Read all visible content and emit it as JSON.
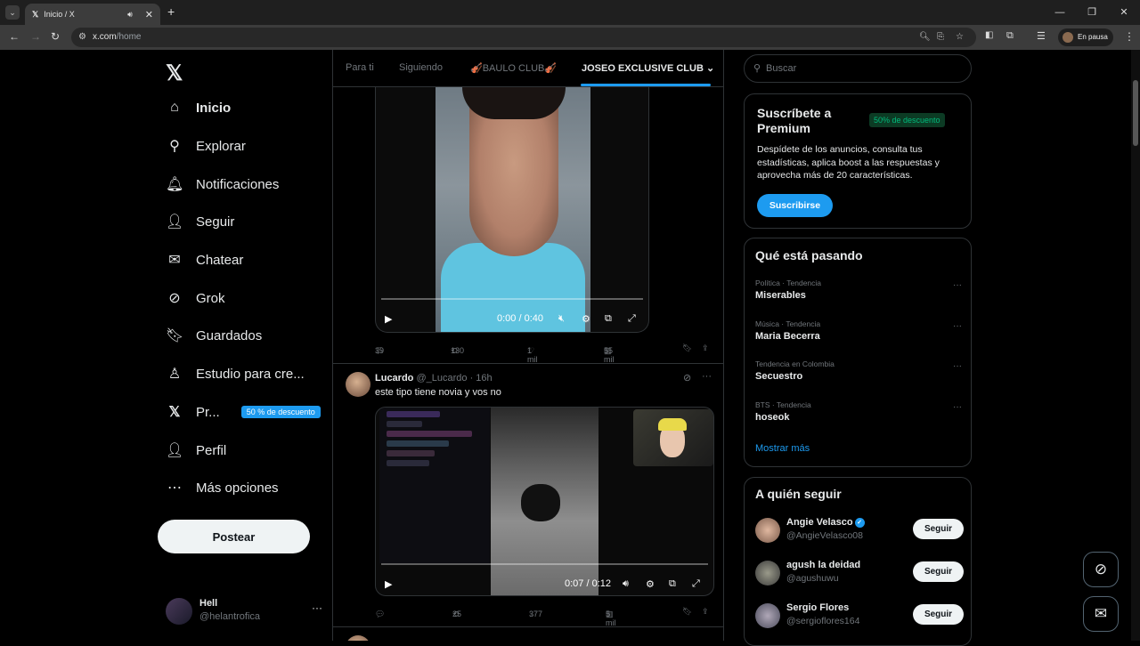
{
  "browser": {
    "tab_title": "Inicio / X",
    "tab_icon": "x-logo-icon",
    "url_domain": "x.com",
    "url_path": "/home",
    "profile_status": "En pausa"
  },
  "sidebar": {
    "logo": "𝕏",
    "items": [
      {
        "label": "Inicio",
        "icon": "home-icon"
      },
      {
        "label": "Explorar",
        "icon": "search-icon"
      },
      {
        "label": "Notificaciones",
        "icon": "bell-icon"
      },
      {
        "label": "Seguir",
        "icon": "add-user-icon"
      },
      {
        "label": "Chatear",
        "icon": "mail-icon"
      },
      {
        "label": "Grok",
        "icon": "grok-icon"
      },
      {
        "label": "Guardados",
        "icon": "bookmark-icon"
      },
      {
        "label": "Estudio para cre...",
        "icon": "studio-icon"
      },
      {
        "label": "Pr...",
        "icon": "x-premium-icon",
        "badge": "50 % de descuento"
      },
      {
        "label": "Perfil",
        "icon": "person-icon"
      },
      {
        "label": "Más opciones",
        "icon": "more-circle-icon"
      }
    ],
    "post_button": "Postear",
    "account": {
      "name": "Hell",
      "handle": "@helantrofica",
      "more": "···"
    }
  },
  "feed": {
    "tabs": [
      "Para ti",
      "Siguiendo",
      "🎻BAULO CLUB🎻",
      "JOSEO EXCLUSIVE CLUB"
    ],
    "active_tab": "JOSEO EXCLUSIVE CLUB",
    "active_tab_chevron": "⌄",
    "tweet1": {
      "video_time": "0:00 / 0:40",
      "replies": "39",
      "reposts": "130",
      "likes": "1 mil",
      "views": "55 mil"
    },
    "tweet2": {
      "name": "Lucardo",
      "handle": "@_Lucardo",
      "time": "· 16h",
      "text": "este tipo tiene novia y vos no",
      "video_time": "0:07 / 0:12",
      "replies": "",
      "reposts": "25",
      "likes": "377",
      "views": "5 mil"
    }
  },
  "right": {
    "search_placeholder": "Buscar",
    "premium": {
      "title": "Suscríbete a Premium",
      "discount": "50% de descuento",
      "description": "Despídete de los anuncios, consulta tus estadísticas, aplica boost a las respuestas y aprovecha más de 20 características.",
      "button": "Suscribirse"
    },
    "trending": {
      "title": "Qué está pasando",
      "items": [
        {
          "context": "Política · Tendencia",
          "name": "Miserables"
        },
        {
          "context": "Música · Tendencia",
          "name": "Maria Becerra"
        },
        {
          "context": "Tendencia en Colombia",
          "name": "Secuestro"
        },
        {
          "context": "BTS · Tendencia",
          "name": "hoseok"
        }
      ],
      "show_more": "Mostrar más"
    },
    "who_to_follow": {
      "title": "A quién seguir",
      "users": [
        {
          "name": "Angie Velasco",
          "handle": "@AngieVelasco08",
          "verified": true,
          "button": "Seguir"
        },
        {
          "name": "agush la deidad",
          "handle": "@agushuwu",
          "verified": false,
          "button": "Seguir"
        },
        {
          "name": "Sergio Flores",
          "handle": "@sergioflores164",
          "verified": false,
          "button": "Seguir"
        }
      ]
    }
  },
  "colors": {
    "accent": "#1d9bf0",
    "background": "#000000",
    "border": "#2f3336",
    "muted": "#71767b",
    "premium_tag": "#00ba7c"
  }
}
